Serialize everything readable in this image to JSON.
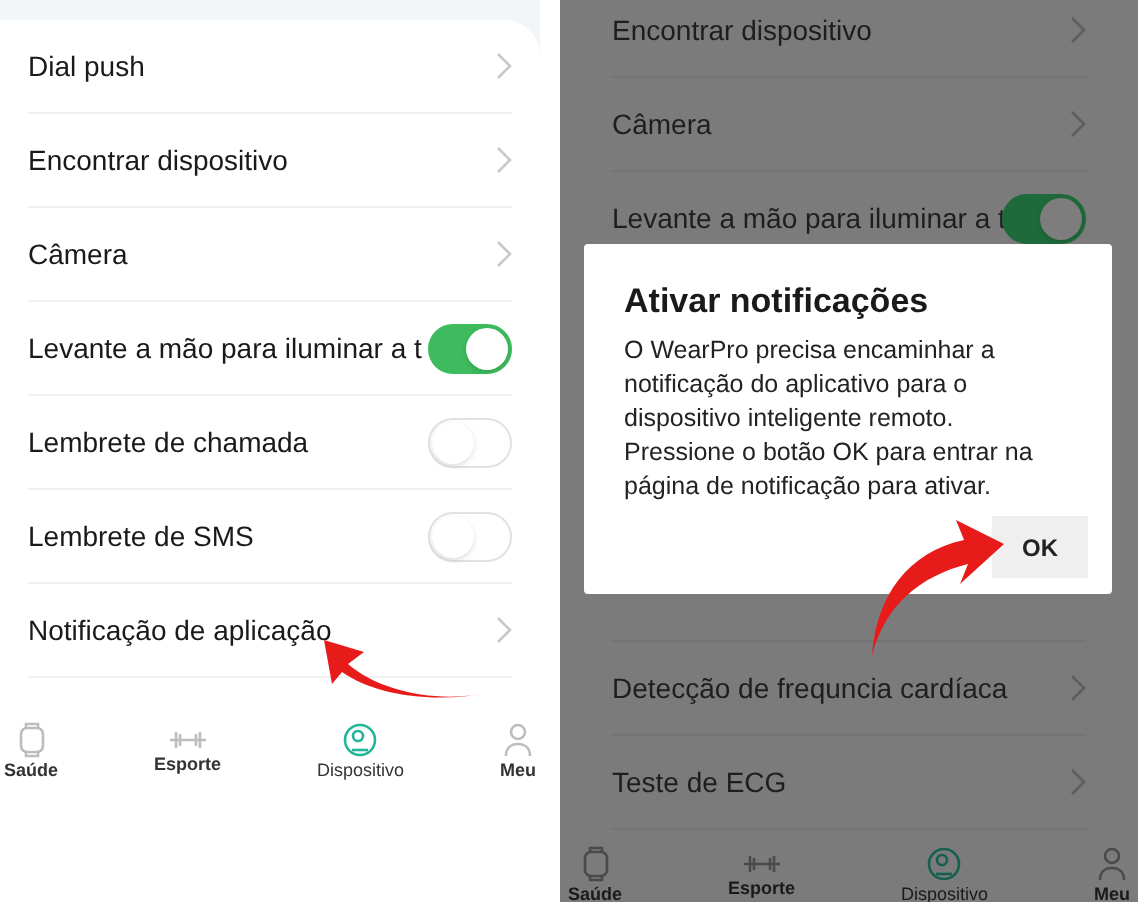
{
  "left_screen": {
    "rows": [
      {
        "kind": "link",
        "label": "Dial push"
      },
      {
        "kind": "link",
        "label": "Encontrar dispositivo"
      },
      {
        "kind": "link",
        "label": "Câmera"
      },
      {
        "kind": "toggle",
        "label": "Levante a mão para iluminar a t",
        "on": true
      },
      {
        "kind": "toggle",
        "label": "Lembrete de chamada",
        "on": false
      },
      {
        "kind": "toggle",
        "label": "Lembrete de SMS",
        "on": false
      },
      {
        "kind": "link",
        "label": "Notificação de aplicação"
      }
    ],
    "nav": [
      {
        "label": "Saúde",
        "selected": false
      },
      {
        "label": "Esporte",
        "selected": false
      },
      {
        "label": "Dispositivo",
        "selected": true
      },
      {
        "label": "Meu",
        "selected": false
      }
    ]
  },
  "right_screen": {
    "rows_top": [
      {
        "kind": "link",
        "label": "Encontrar dispositivo"
      },
      {
        "kind": "link",
        "label": "Câmera"
      },
      {
        "kind": "toggle",
        "label": "Levante a mão para iluminar a t",
        "on": true
      }
    ],
    "rows_bottom": [
      {
        "kind": "link",
        "label": "Detecção de frequncia cardíaca"
      },
      {
        "kind": "link",
        "label": "Teste de ECG"
      }
    ],
    "dialog": {
      "title": "Ativar notificações",
      "message": "O WearPro precisa encaminhar a notificação do aplicativo para o dispositivo inteligente remoto. Pressione o botão OK para entrar na página de notificação para ativar.",
      "button": "OK"
    },
    "nav": [
      {
        "label": "Saúde",
        "selected": false
      },
      {
        "label": "Esporte",
        "selected": false
      },
      {
        "label": "Dispositivo",
        "selected": true
      },
      {
        "label": "Meu",
        "selected": false
      }
    ]
  }
}
